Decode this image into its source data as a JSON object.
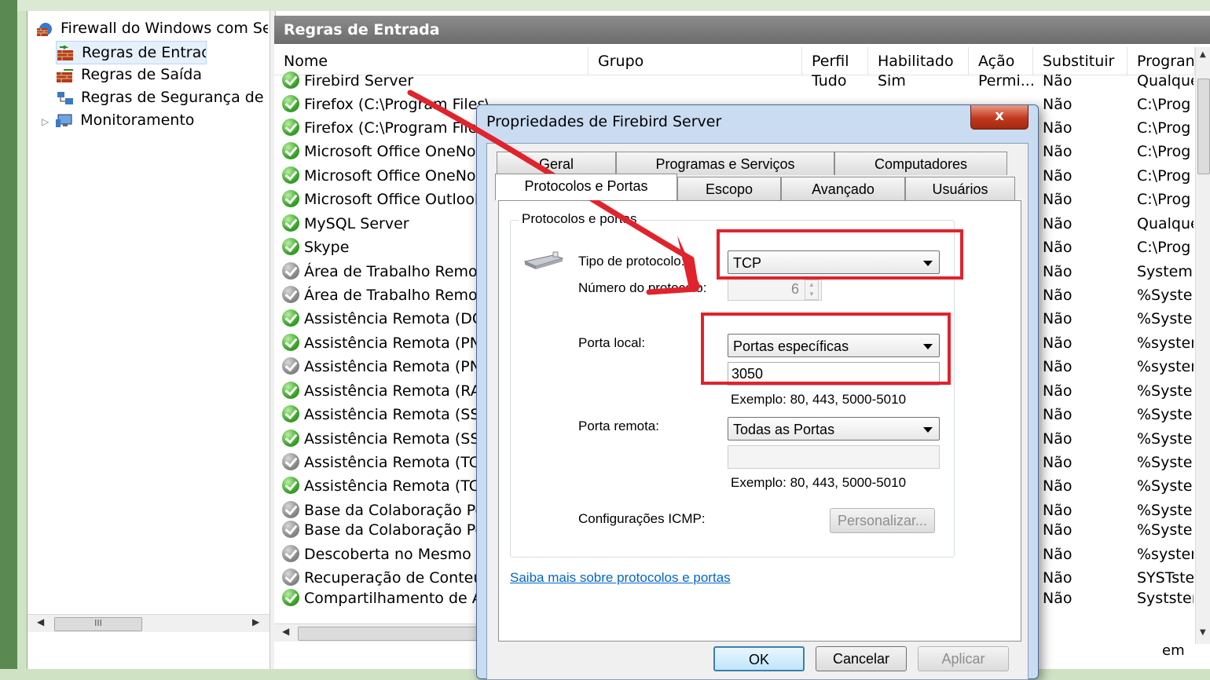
{
  "tree": {
    "items": [
      {
        "label": "Firewall do Windows com Segu",
        "icon": "firewall-icon"
      },
      {
        "label": "Regras de Entrada",
        "icon": "inbound-rules-icon"
      },
      {
        "label": "Regras de Saída",
        "icon": "outbound-rules-icon"
      },
      {
        "label": "Regras de Segurança de Co",
        "icon": "security-rules-icon"
      },
      {
        "label": "Monitoramento",
        "icon": "monitor-icon"
      }
    ],
    "expander": "▷",
    "scroll_thumb": "III"
  },
  "pane": {
    "title": "Regras de Entrada",
    "columns": [
      "Nome",
      "Grupo",
      "Perfil",
      "Habilitado",
      "Ação",
      "Substituir",
      "Progran"
    ],
    "rows": [
      {
        "name": "Firebird Server",
        "enabled": true,
        "perfil": "Tudo",
        "habilitado": "Sim",
        "acao": "Permi...",
        "substituir": "Não",
        "programa": "Qualque"
      },
      {
        "name": "Firefox (C:\\Program Files\\",
        "enabled": true,
        "substituir": "Não",
        "programa": "C:\\Prog"
      },
      {
        "name": "Firefox (C:\\Program Files",
        "enabled": true,
        "substituir": "Não",
        "programa": "C:\\Prog"
      },
      {
        "name": "Microsoft Office OneNote",
        "enabled": true,
        "substituir": "Não",
        "programa": "C:\\Prog"
      },
      {
        "name": "Microsoft Office OneNote",
        "enabled": true,
        "substituir": "Não",
        "programa": "C:\\Prog"
      },
      {
        "name": "Microsoft Office Outlook",
        "enabled": true,
        "substituir": "Não",
        "programa": "C:\\Prog"
      },
      {
        "name": "MySQL Server",
        "enabled": true,
        "substituir": "Não",
        "programa": "Qualque"
      },
      {
        "name": "Skype",
        "enabled": true,
        "substituir": "Não",
        "programa": "C:\\Prog"
      },
      {
        "name": "Área de Trabalho Remota",
        "enabled": false,
        "substituir": "Não",
        "programa": "System"
      },
      {
        "name": "Área de Trabalho Remota",
        "enabled": false,
        "substituir": "Não",
        "programa": "%Syster"
      },
      {
        "name": "Assistência Remota (DCOM",
        "enabled": true,
        "substituir": "Não",
        "programa": "%Syster"
      },
      {
        "name": "Assistência Remota (PNRP",
        "enabled": true,
        "substituir": "Não",
        "programa": "%syster"
      },
      {
        "name": "Assistência Remota (PNRP",
        "enabled": false,
        "substituir": "Não",
        "programa": "%syster"
      },
      {
        "name": "Assistência Remota (RA Se",
        "enabled": true,
        "substituir": "Não",
        "programa": "%Syster"
      },
      {
        "name": "Assistência Remota (SSDP",
        "enabled": true,
        "substituir": "Não",
        "programa": "%Syster"
      },
      {
        "name": "Assistência Remota (SSDP",
        "enabled": true,
        "substituir": "Não",
        "programa": "%Syster"
      },
      {
        "name": "Assistência Remota (TCP-",
        "enabled": false,
        "substituir": "Não",
        "programa": "%Syster"
      },
      {
        "name": "Assistência Remota (TCP-",
        "enabled": true,
        "substituir": "Não",
        "programa": "%Syster"
      },
      {
        "name": "Base da Colaboração Pont",
        "enabled": false,
        "substituir": "Não",
        "programa": "%Syster"
      },
      {
        "name": "Base da Colaboração Pont",
        "enabled": false,
        "substituir": "Não",
        "programa": "%Syster"
      },
      {
        "name": "Descoberta no Mesmo Nív",
        "enabled": false,
        "substituir": "Não",
        "programa": "%syster"
      },
      {
        "name": "Recuperação de Conteúdo",
        "enabled": false,
        "substituir": "Não",
        "programa": "SYSTster"
      },
      {
        "name": "Compartilhamento de Arq",
        "enabled": true,
        "substituir": "Não",
        "programa": "Systster"
      }
    ],
    "bottom_text": "em"
  },
  "dialog": {
    "title": "Propriedades de Firebird Server",
    "close": "x",
    "tabs_back": [
      "Geral",
      "Programas e Serviços",
      "Computadores"
    ],
    "tabs_front": [
      "Protocolos e Portas",
      "Escopo",
      "Avançado",
      "Usuários"
    ],
    "group_label": "Protocolos e portas",
    "protocol_type_label": "Tipo de protocolo:",
    "protocol_type_value": "TCP",
    "protocol_number_label": "Número do protocolo:",
    "protocol_number_value": "6",
    "local_port_label": "Porta local:",
    "local_port_select": "Portas específicas",
    "local_port_value": "3050",
    "example_text": "Exemplo: 80, 443, 5000-5010",
    "remote_port_label": "Porta remota:",
    "remote_port_select": "Todas as Portas",
    "remote_port_value": "",
    "remote_example_text": "Exemplo: 80, 443, 5000-5010",
    "icmp_label": "Configurações ICMP:",
    "customize_button": "Personalizar...",
    "learn_more_link": "Saiba mais sobre protocolos e portas",
    "ok_button": "OK",
    "cancel_button": "Cancelar",
    "apply_button": "Aplicar"
  },
  "colors": {
    "annotation_red": "#e0232d",
    "header_band": "#1d4fa8"
  }
}
